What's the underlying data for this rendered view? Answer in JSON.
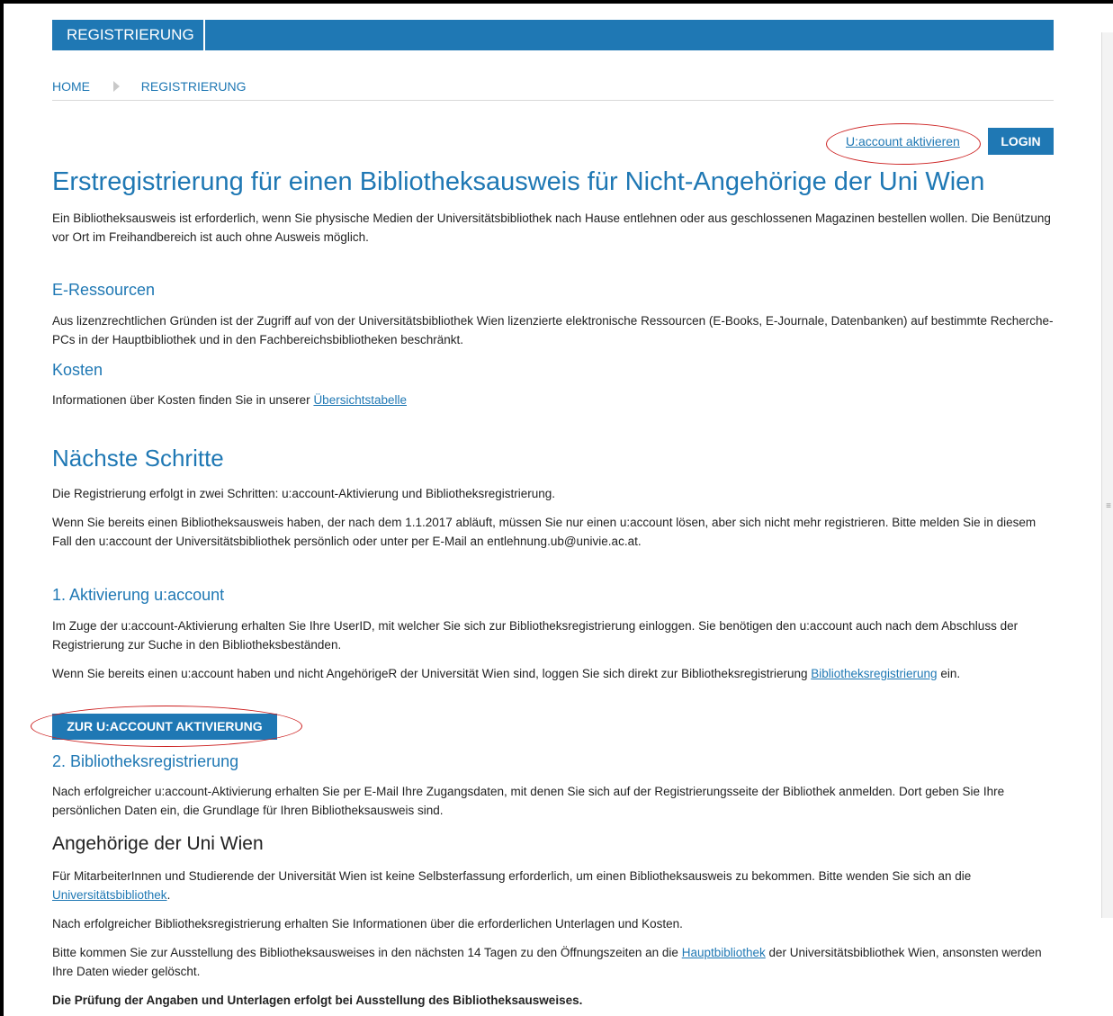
{
  "nav": {
    "tab_label": "REGISTRIERUNG"
  },
  "breadcrumb": {
    "home": "HOME",
    "current": "REGISTRIERUNG"
  },
  "account": {
    "activate_link": "U:account aktivieren",
    "login_label": "LOGIN"
  },
  "page": {
    "title": "Erstregistrierung für einen Bibliotheksausweis für Nicht-Angehörige der Uni Wien",
    "intro": "Ein Bibliotheksausweis ist erforderlich, wenn Sie physische Medien der Universitätsbibliothek nach Hause entlehnen oder aus geschlossenen Magazinen bestellen wollen. Die Benützung vor Ort im Freihandbereich ist auch ohne Ausweis möglich."
  },
  "eresources": {
    "heading": "E-Ressourcen",
    "text": "Aus lizenzrechtlichen Gründen ist der Zugriff auf von der Universitätsbibliothek Wien lizenzierte elektronische Ressourcen (E-Books, E-Journale, Datenbanken) auf bestimmte Recherche-PCs in der Hauptbibliothek und in den Fachbereichsbibliotheken beschränkt."
  },
  "costs": {
    "heading": "Kosten",
    "text_before": "Informationen über Kosten finden Sie in unserer ",
    "link": "Übersichtstabelle"
  },
  "next_steps": {
    "heading": "Nächste Schritte",
    "p1": "Die Registrierung erfolgt in zwei Schritten: u:account-Aktivierung und Bibliotheksregistrierung.",
    "p2": "Wenn Sie bereits einen Bibliotheksausweis haben, der nach dem 1.1.2017 abläuft, müssen Sie nur einen u:account lösen, aber sich nicht mehr registrieren. Bitte melden Sie in diesem Fall den u:account der Universitätsbibliothek persönlich oder unter per E-Mail an entlehnung.ub@univie.ac.at."
  },
  "step1": {
    "heading": "1. Aktivierung u:account",
    "p1": "Im Zuge der u:account-Aktivierung erhalten Sie Ihre UserID, mit welcher Sie sich zur Bibliotheksregistrierung einloggen. Sie benötigen den u:account auch nach dem Abschluss der Registrierung zur Suche in den Bibliotheksbeständen.",
    "p2_before": "Wenn Sie bereits einen u:account haben und nicht AngehörigeR der Universität Wien sind, loggen Sie sich direkt zur Bibliotheksregistrierung ",
    "p2_link": "Bibliotheksregistrierung",
    "p2_after": " ein.",
    "button": "ZUR U:ACCOUNT AKTIVIERUNG"
  },
  "step2": {
    "heading": "2. Bibliotheksregistrierung",
    "text": "Nach erfolgreicher u:account-Aktivierung erhalten Sie per E-Mail Ihre Zugangsdaten, mit denen Sie sich auf der Registrierungsseite der Bibliothek anmelden. Dort geben Sie Ihre persönlichen Daten ein, die Grundlage für Ihren Bibliotheksausweis sind."
  },
  "members": {
    "heading": "Angehörige der Uni Wien",
    "p1_before": "Für MitarbeiterInnen und Studierende der Universität Wien ist keine Selbsterfassung erforderlich, um einen Bibliotheksausweis zu bekommen. Bitte wenden Sie sich an die ",
    "p1_link": "Universitätsbibliothek",
    "p1_after": ".",
    "p2": "Nach erfolgreicher Bibliotheksregistrierung erhalten Sie Informationen über die erforderlichen Unterlagen und Kosten.",
    "p3_before": "Bitte kommen Sie zur Ausstellung des Bibliotheksausweises in den nächsten 14 Tagen zu den Öffnungszeiten an die ",
    "p3_link": "Hauptbibliothek",
    "p3_after": " der Universitätsbibliothek Wien, ansonsten werden Ihre Daten wieder gelöscht.",
    "p4": "Die Prüfung der Angaben und Unterlagen erfolgt bei Ausstellung des Bibliotheksausweises."
  }
}
